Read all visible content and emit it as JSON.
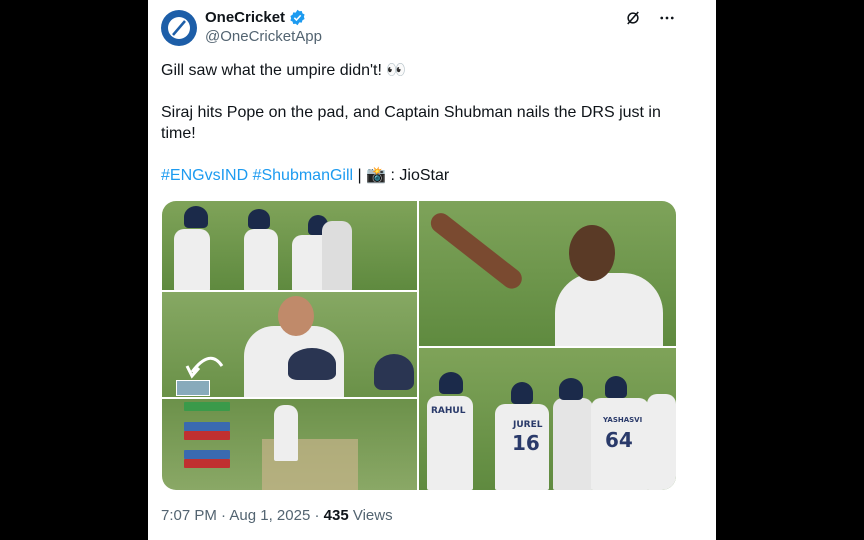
{
  "account": {
    "name": "OneCricket",
    "handle": "@OneCricketApp",
    "verified": true
  },
  "tweet": {
    "line1": "Gill saw what the umpire didn't! 👀",
    "line2": "Siraj hits Pope on the pad, and Captain Shubman nails the DRS just in time!",
    "hashtag1": "#ENGvsIND",
    "hashtag2": "#ShubmanGill",
    "separator": " | ",
    "camera": "📸",
    "credit": " : JioStar"
  },
  "media": {
    "jersey_numbers": {
      "left": "16",
      "right": "64"
    },
    "jersey_names": {
      "jurel": "JUREL",
      "rahul": "RAHUL",
      "yashasvi": "YASHASVI"
    }
  },
  "footer": {
    "time": "7:07 PM",
    "sep": " · ",
    "date": "Aug 1, 2025",
    "views_count": "435",
    "views_label": " Views"
  },
  "colors": {
    "brand": "#1d5ea8",
    "link": "#1d9bf0",
    "verified": "#1d9bf0"
  }
}
